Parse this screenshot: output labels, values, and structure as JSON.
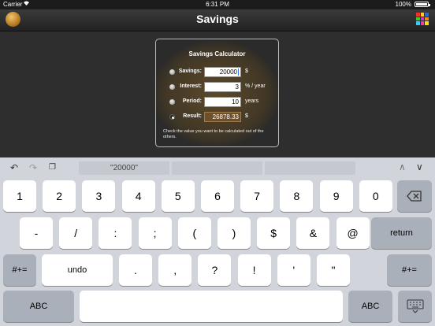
{
  "status_bar": {
    "carrier": "Carrier",
    "time": "6:31 PM",
    "battery": "100%"
  },
  "nav": {
    "title": "Savings"
  },
  "calculator": {
    "title": "Savings Calculator",
    "rows": [
      {
        "label": "Savings:",
        "value": "20000",
        "unit": "$",
        "selected": false
      },
      {
        "label": "Interest:",
        "value": "3",
        "unit": "% / year",
        "selected": false
      },
      {
        "label": "Period:",
        "value": "10",
        "unit": "years",
        "selected": false
      },
      {
        "label": "Result:",
        "value": "26878.33",
        "unit": "$",
        "selected": true
      }
    ],
    "hint": "Check the value you want to be calculated out of the others."
  },
  "keyboard": {
    "prediction": "\"20000\"",
    "row1": [
      "1",
      "2",
      "3",
      "4",
      "5",
      "6",
      "7",
      "8",
      "9",
      "0"
    ],
    "row2": [
      "-",
      "/",
      ":",
      ";",
      "(",
      ")",
      "$",
      "&",
      "@"
    ],
    "return_label": "return",
    "symbols_label": "#+=",
    "undo_label": "undo",
    "row3": [
      ".",
      ",",
      "?",
      "!",
      "'",
      "\""
    ],
    "abc_label": "ABC"
  }
}
